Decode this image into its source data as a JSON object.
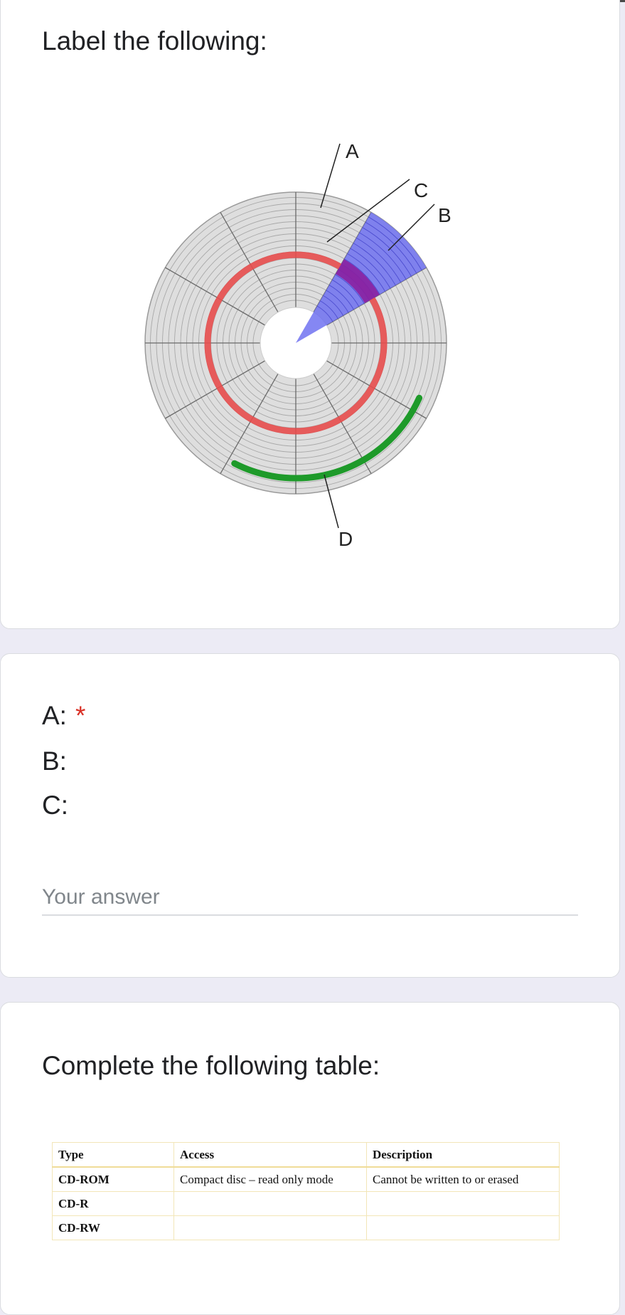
{
  "card1": {
    "title": "Label the following:",
    "diagram_labels": {
      "a": "A",
      "b": "B",
      "c": "C",
      "d": "D"
    }
  },
  "card2": {
    "lines": [
      {
        "label": "A:",
        "required_mark": "*"
      },
      {
        "label": "B:"
      },
      {
        "label": "C:"
      }
    ],
    "placeholder": "Your answer"
  },
  "card3": {
    "title": "Complete the following table:",
    "table": {
      "headers": [
        "Type",
        "Access",
        "Description"
      ],
      "rows": [
        [
          "CD-ROM",
          "Compact disc – read only mode",
          "Cannot be written to or erased"
        ],
        [
          "CD-R",
          "",
          ""
        ],
        [
          "CD-RW",
          "",
          ""
        ]
      ]
    }
  },
  "colors": {
    "page_bg": "#ecebf5",
    "track_highlight": "#e74c4c",
    "sector_highlight": "#6a6cf0",
    "block_highlight": "#8a1fa0",
    "cluster_highlight": "#1e9a2a",
    "required": "#d93025"
  }
}
